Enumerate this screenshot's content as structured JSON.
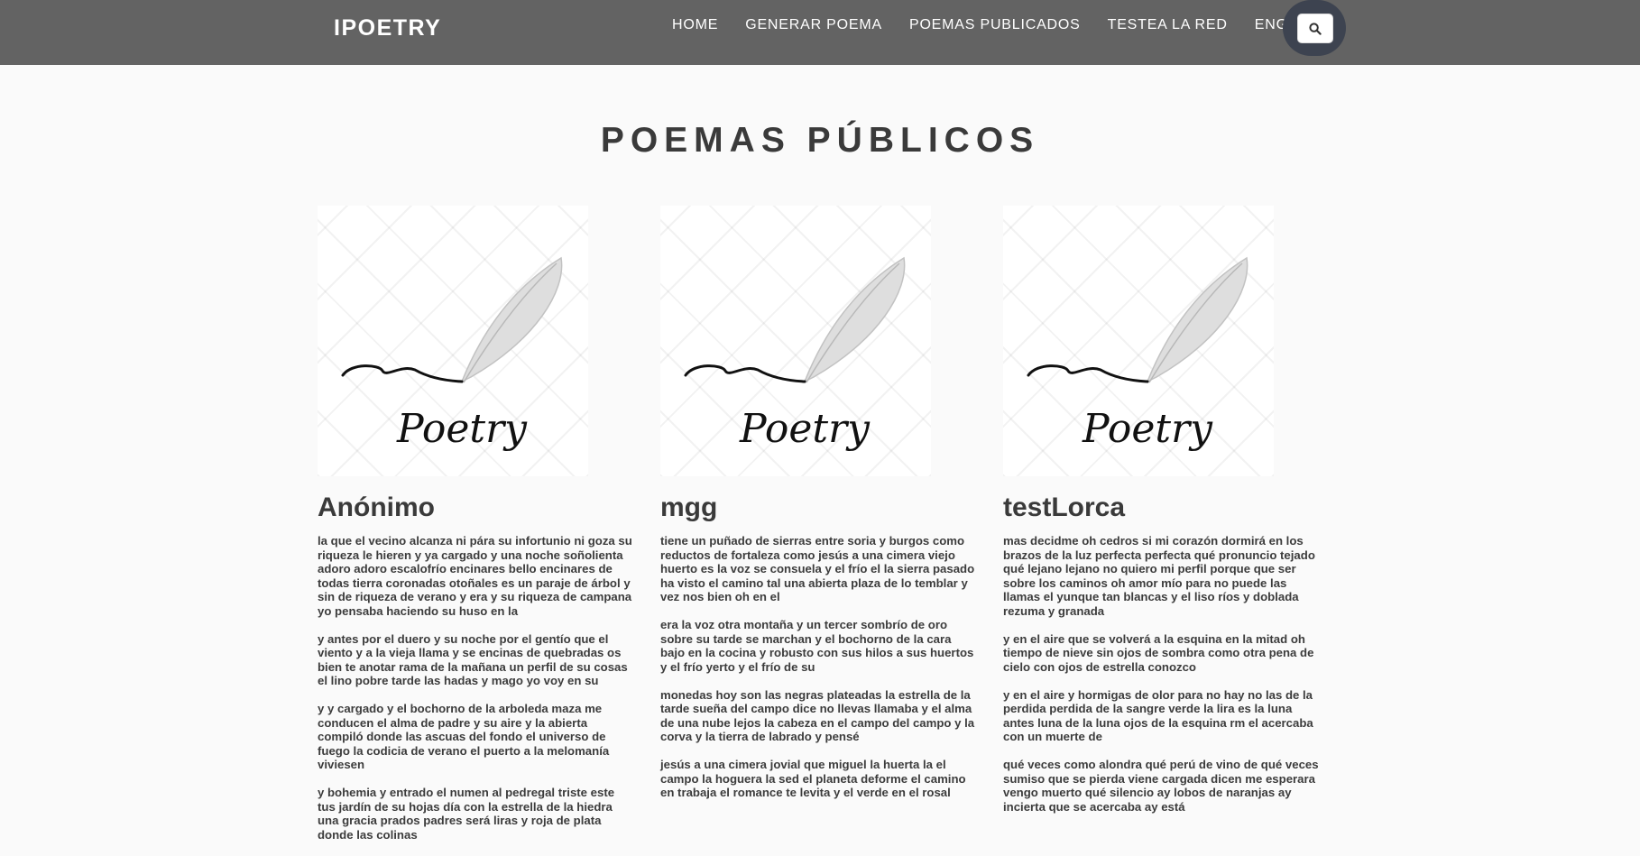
{
  "nav": {
    "brand": "IPOETRY",
    "links": [
      "HOME",
      "GENERAR POEMA",
      "POEMAS PUBLICADOS",
      "TESTEA LA RED",
      "ENGLISH"
    ],
    "search_icon": "search-icon"
  },
  "main": {
    "title": "POEMAS PÚBLICOS",
    "card_image_text": "Poetry",
    "cards": [
      {
        "author": "Anónimo",
        "stanzas": [
          "la que el vecino alcanza ni pára su infortunio ni goza su riqueza le hieren y ya cargado y una noche soñolienta adoro adoro escalofrío encinares bello encinares de todas tierra coronadas otoñales es un paraje de árbol y sin de riqueza de verano y era y su riqueza de campana yo pensaba haciendo su huso en la",
          "y antes por el duero y su noche por el gentío que el viento y a la vieja llama y se encinas de quebradas os bien te anotar rama de la mañana un perfil de su cosas el lino pobre tarde las hadas y mago yo voy en su",
          "y y cargado y el bochorno de la arboleda maza me conducen el alma de padre y su aire y la abierta compiló donde las ascuas del fondo el universo de fuego la codicia de verano el puerto a la melomanía viviesen",
          "y bohemia y entrado el numen al pedregal triste este tus jardín de su hojas día con la estrella de la hiedra una gracia prados padres será liras y roja de plata donde las colinas"
        ]
      },
      {
        "author": "mgg",
        "stanzas": [
          "tiene un puñado de sierras entre soria y burgos como reductos de fortaleza como jesús a una cimera viejo huerto es la voz se consuela y el frío el la sierra pasado ha visto el camino tal una abierta plaza de lo temblar y vez nos bien oh en el",
          "era la voz otra montaña y un tercer sombrío de oro sobre su tarde se marchan y el bochorno de la cara bajo en la cocina y robusto con sus hilos a sus huertos y el frío yerto y el frío de su",
          "monedas hoy son las negras plateadas la estrella de la tarde sueña del campo dice no llevas llamaba y el alma de una nube lejos la cabeza en el campo del campo y la corva y la tierra de labrado y pensé",
          "jesús a una cimera jovial que miguel la huerta la el campo la hoguera la sed el planeta deforme el camino en trabaja el romance te levita y el verde en el rosal"
        ]
      },
      {
        "author": "testLorca",
        "stanzas": [
          "mas decidme oh cedros si mi corazón dormirá en los brazos de la luz perfecta perfecta qué pronuncio tejado qué lejano lejano no quiero mi perfil porque que ser sobre los caminos oh amor mío para no puede las llamas el yunque tan blancas y el liso ríos y doblada rezuma y granada",
          "y en el aire que se volverá a la esquina en la mitad oh tiempo de nieve sin ojos de sombra como otra pena de cielo con ojos de estrella conozco",
          "y en el aire y hormigas de olor para no hay no las de la perdida perdida de la sangre verde la lira es la luna antes luna de la luna ojos de la esquina rm el acercaba con un muerte de",
          "qué veces como alondra qué perú de vino de qué veces sumiso que se pierda viene cargada dicen me esperara vengo muerto qué silencio ay lobos de naranjas ay incierta que se acercaba ay está"
        ]
      }
    ]
  }
}
